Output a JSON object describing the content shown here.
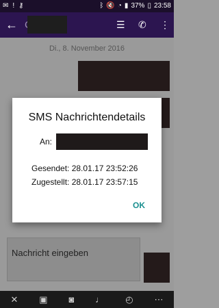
{
  "statusbar": {
    "battery": "37%",
    "time": "23:58"
  },
  "chat": {
    "date": "Di., 8. November 2016"
  },
  "compose": {
    "placeholder": "Nachricht eingeben"
  },
  "dialog": {
    "title": "SMS Nachrichtendetails",
    "to_label": "An:",
    "sent": "Gesendet: 28.01.17 23:52:26",
    "delivered": "Zugestellt: 28.01.17 23:57:15",
    "ok": "OK"
  },
  "appbar": {
    "contact_initial": "C"
  }
}
